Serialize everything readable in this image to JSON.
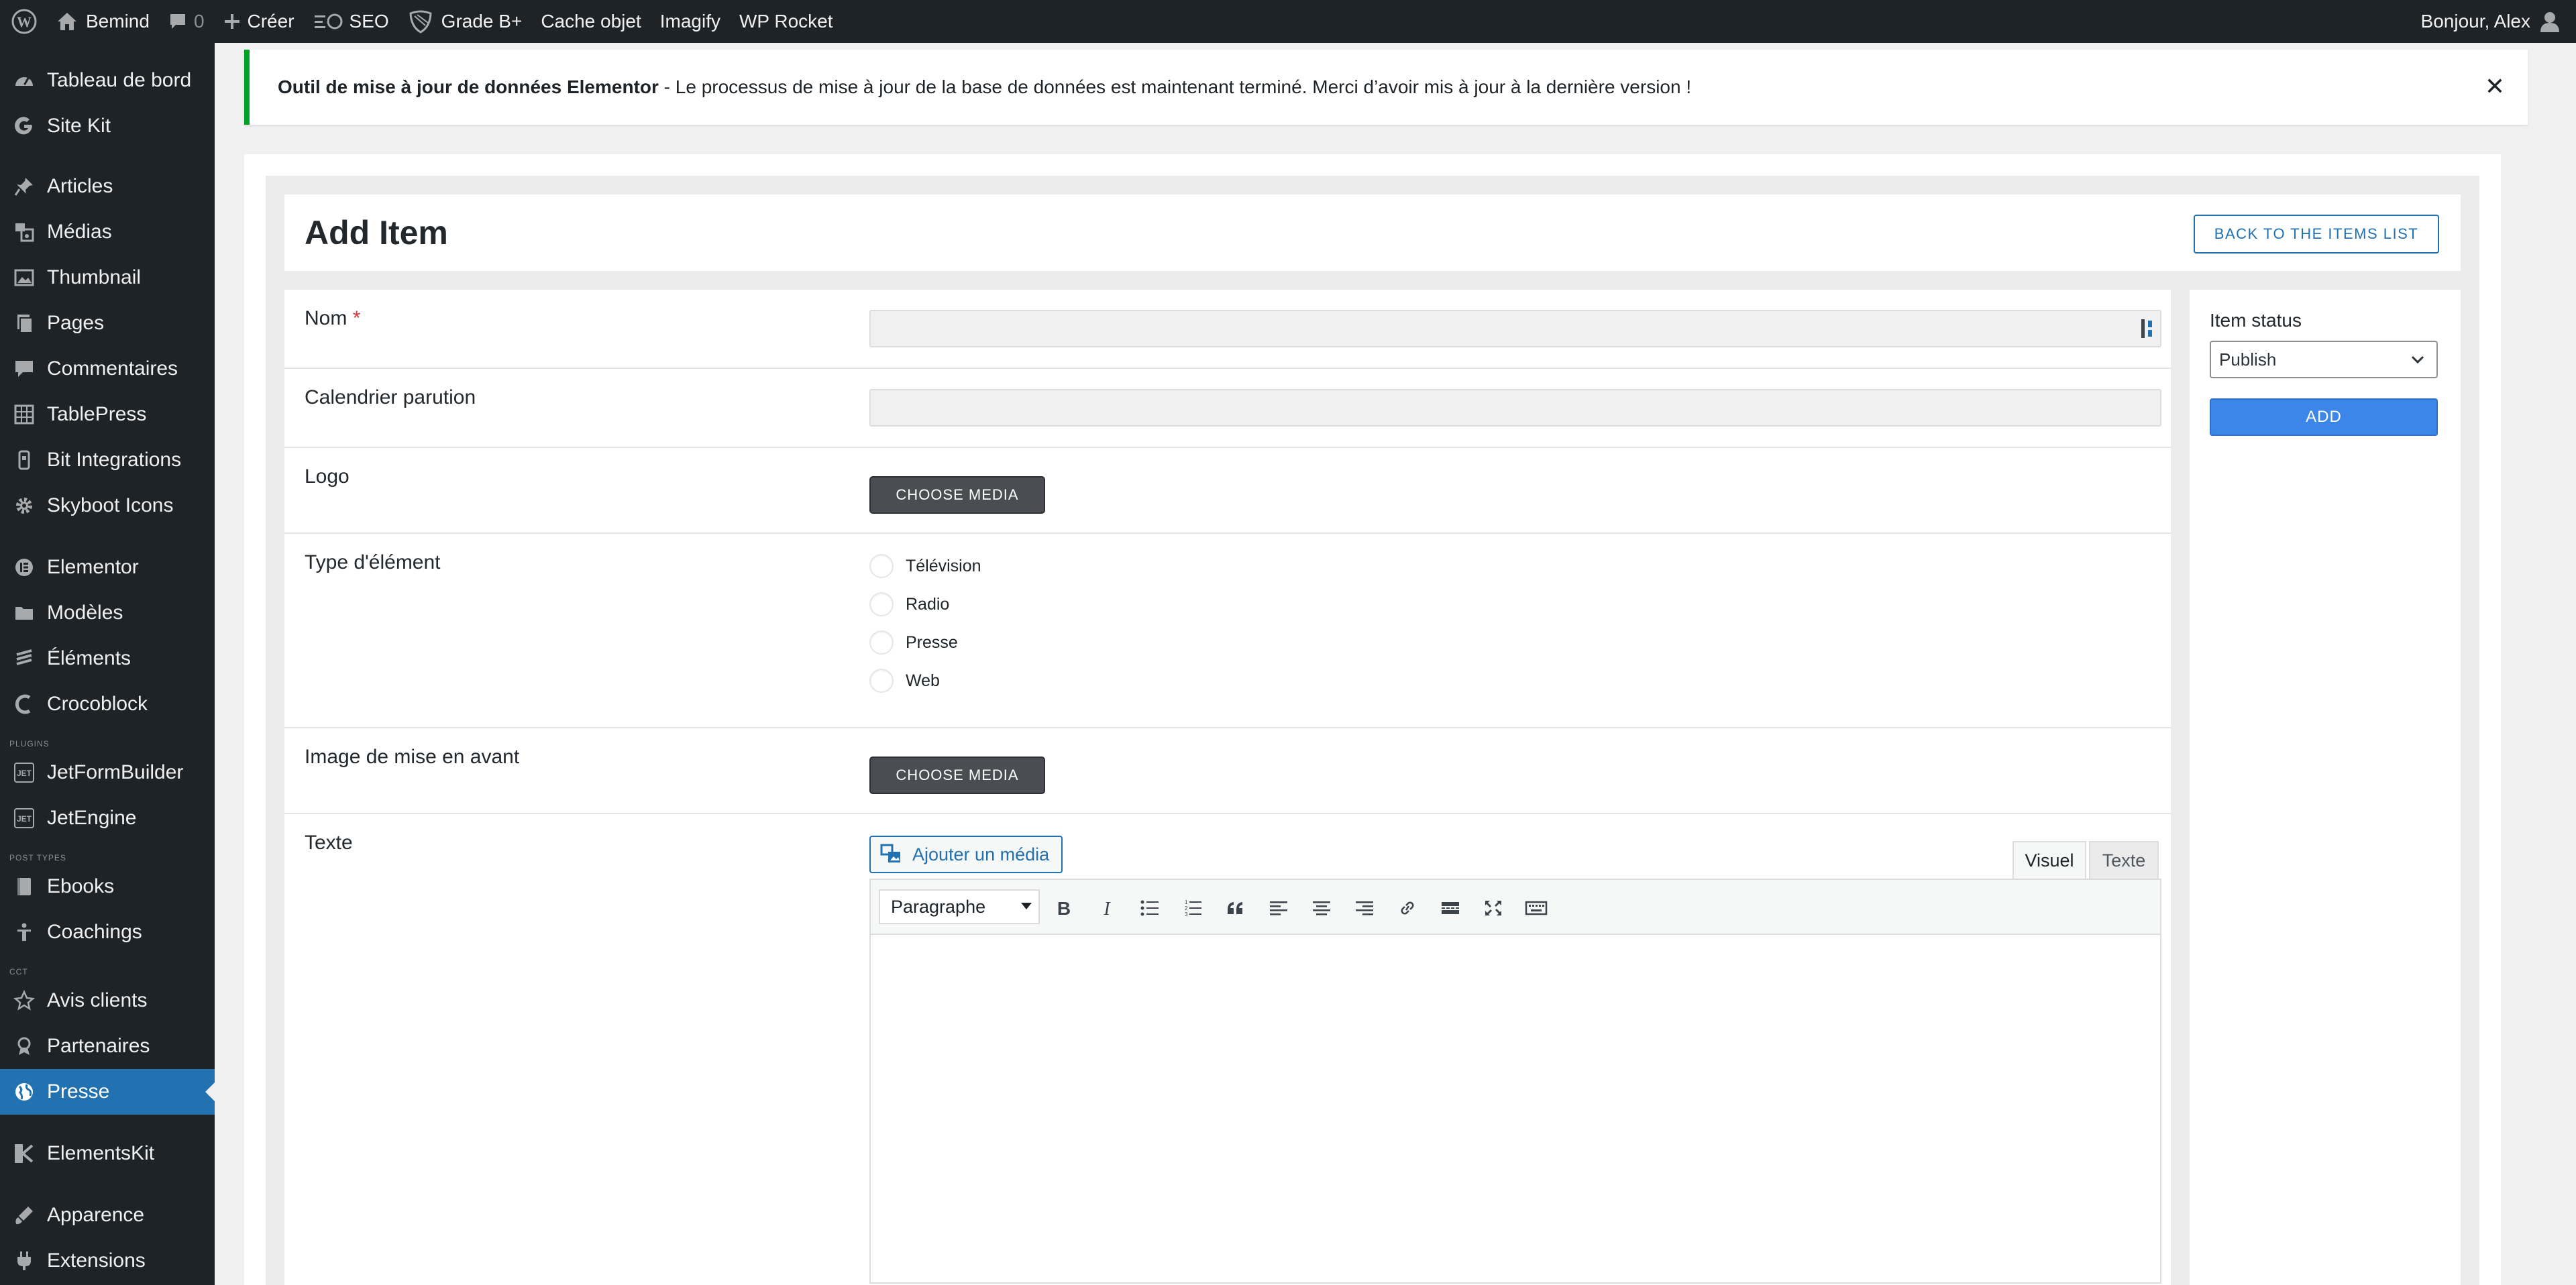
{
  "adminbar": {
    "site_name": "Bemind",
    "comments_count": "0",
    "new_label": "Créer",
    "seo_label": "SEO",
    "grade_label": "Grade B+",
    "cache_label": "Cache objet",
    "imagify_label": "Imagify",
    "wprocket_label": "WP Rocket",
    "greeting": "Bonjour, Alex"
  },
  "sidebar": {
    "items": [
      {
        "label": "Tableau de bord",
        "icon": "dashboard-icon"
      },
      {
        "label": "Site Kit",
        "icon": "google-icon"
      },
      {
        "label": "Articles",
        "icon": "pin-icon"
      },
      {
        "label": "Médias",
        "icon": "media-icon"
      },
      {
        "label": "Thumbnail",
        "icon": "image-icon"
      },
      {
        "label": "Pages",
        "icon": "page-icon"
      },
      {
        "label": "Commentaires",
        "icon": "comment-icon"
      },
      {
        "label": "TablePress",
        "icon": "table-icon"
      },
      {
        "label": "Bit Integrations",
        "icon": "plug-icon"
      },
      {
        "label": "Skyboot Icons",
        "icon": "gear-icon"
      },
      {
        "label": "Elementor",
        "icon": "elementor-icon"
      },
      {
        "label": "Modèles",
        "icon": "folder-icon"
      },
      {
        "label": "Éléments",
        "icon": "brush-icon"
      },
      {
        "label": "Crocoblock",
        "icon": "crocoblock-icon"
      },
      {
        "label": "JetFormBuilder",
        "icon": "jet-icon"
      },
      {
        "label": "JetEngine",
        "icon": "jet-icon"
      },
      {
        "label": "Ebooks",
        "icon": "book-icon"
      },
      {
        "label": "Coachings",
        "icon": "person-icon"
      },
      {
        "label": "Avis clients",
        "icon": "star-icon"
      },
      {
        "label": "Partenaires",
        "icon": "award-icon"
      },
      {
        "label": "Presse",
        "icon": "globe-icon"
      },
      {
        "label": "ElementsKit",
        "icon": "ekit-icon"
      },
      {
        "label": "Apparence",
        "icon": "appearance-icon"
      },
      {
        "label": "Extensions",
        "icon": "plugin-icon"
      }
    ],
    "tags": {
      "plugins": "PLUGINS",
      "post_types": "POST TYPES",
      "cct": "CCT"
    }
  },
  "notice": {
    "title": "Outil de mise à jour de données Elementor",
    "message": " - Le processus de mise à jour de la base de données est maintenant terminé. Merci d’avoir mis à jour à la dernière version !"
  },
  "page": {
    "title": "Add Item",
    "back_button": "BACK TO THE ITEMS LIST"
  },
  "form": {
    "nom_label": "Nom",
    "required_mark": "*",
    "calendrier_label": "Calendrier parution",
    "logo_label": "Logo",
    "choose_media": "CHOOSE MEDIA",
    "type_label": "Type d'élément",
    "type_options": [
      "Télévision",
      "Radio",
      "Presse",
      "Web"
    ],
    "image_label": "Image de mise en avant",
    "texte_label": "Texte",
    "add_media": "Ajouter un média",
    "tab_visual": "Visuel",
    "tab_text": "Texte",
    "format_select": "Paragraphe"
  },
  "side": {
    "status_label": "Item status",
    "status_value": "Publish",
    "add_button": "ADD"
  }
}
